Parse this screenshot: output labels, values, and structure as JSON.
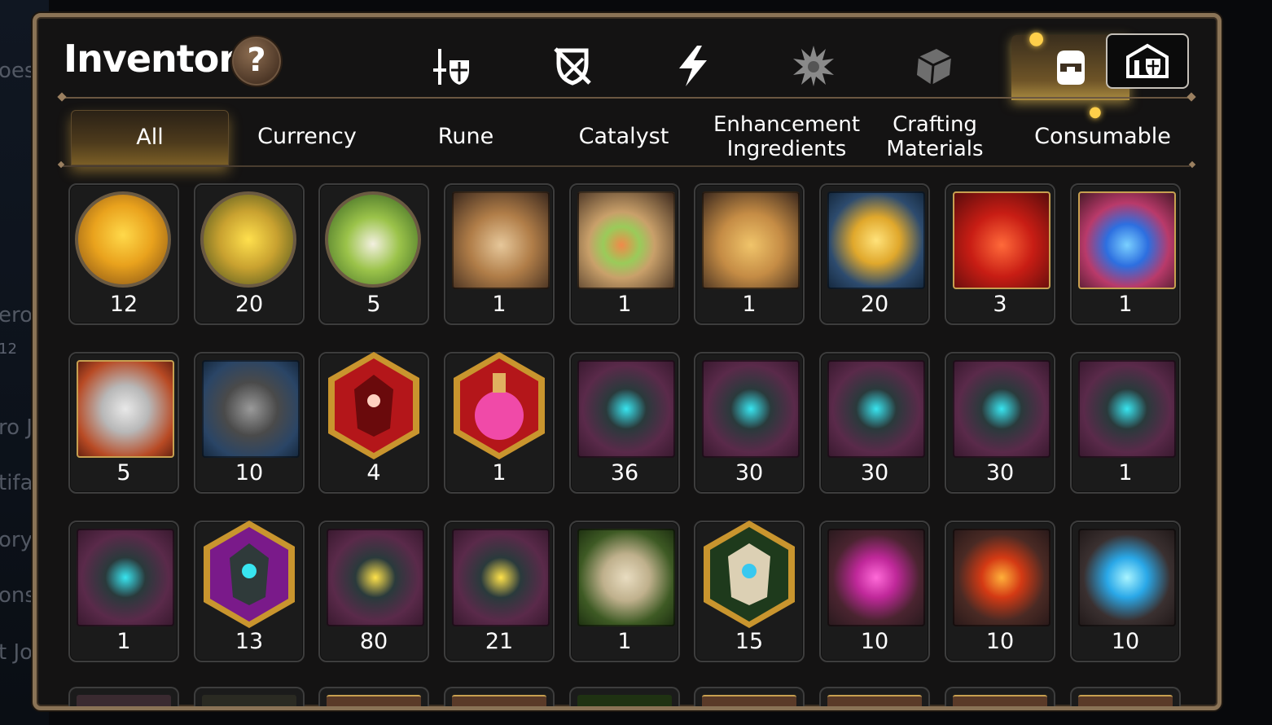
{
  "title": "Inventory",
  "help_label": "?",
  "background_words": [
    "oes",
    "ero",
    "12",
    "ro J",
    "tifa",
    "ory",
    "ons",
    "t Jo"
  ],
  "top_tabs": [
    {
      "name": "heroes-tab",
      "icon": "sword-shield-icon",
      "active": false
    },
    {
      "name": "equipment-tab",
      "icon": "no-sword-shield-icon",
      "active": false
    },
    {
      "name": "skills-tab",
      "icon": "lightning-icon",
      "active": false
    },
    {
      "name": "burst-tab",
      "icon": "burst-icon",
      "active": false
    },
    {
      "name": "cube-tab",
      "icon": "cube-icon",
      "active": false
    },
    {
      "name": "bag-tab",
      "icon": "bag-icon",
      "active": true
    }
  ],
  "shop_icon": "hero-shop-icon",
  "sub_tabs": [
    "All",
    "Currency",
    "Rune",
    "Catalyst",
    "Enhancement Ingredients",
    "Crafting Materials",
    "Consumable"
  ],
  "active_sub_tab": "All",
  "items": [
    {
      "icon": "gold-chick-icon",
      "qty": "12"
    },
    {
      "icon": "deer-chick-icon",
      "qty": "20"
    },
    {
      "icon": "leaf-chick-icon",
      "qty": "5"
    },
    {
      "icon": "scroll-fire-icon",
      "qty": "1"
    },
    {
      "icon": "scroll-rainbow-icon",
      "qty": "1"
    },
    {
      "icon": "scroll-gold-icon",
      "qty": "1"
    },
    {
      "icon": "gold-crystal-cluster-icon",
      "qty": "20"
    },
    {
      "icon": "red-potion-icon",
      "qty": "3"
    },
    {
      "icon": "star-potion-icon",
      "qty": "1"
    },
    {
      "icon": "gold-chest-icon",
      "qty": "5"
    },
    {
      "icon": "silver-chest-icon",
      "qty": "10"
    },
    {
      "icon": "red-star-stone-icon",
      "qty": "4"
    },
    {
      "icon": "pink-potion-icon",
      "qty": "1"
    },
    {
      "icon": "rune-sword-icon",
      "qty": "36"
    },
    {
      "icon": "rune-helmet-icon",
      "qty": "30"
    },
    {
      "icon": "rune-armor-icon",
      "qty": "30"
    },
    {
      "icon": "rune-boot-icon",
      "qty": "30"
    },
    {
      "icon": "rune-ring-icon",
      "qty": "1"
    },
    {
      "icon": "rune-necklace-icon",
      "qty": "1"
    },
    {
      "icon": "purple-star-rune-icon",
      "qty": "13"
    },
    {
      "icon": "gold-hammer-rune-icon",
      "qty": "80"
    },
    {
      "icon": "gold-bolt-rune-icon",
      "qty": "21"
    },
    {
      "icon": "stone-sword-rune-icon",
      "qty": "1"
    },
    {
      "icon": "stone-star-rune-icon",
      "qty": "15"
    },
    {
      "icon": "pink-orb-icon",
      "qty": "10"
    },
    {
      "icon": "fire-orb-icon",
      "qty": "10"
    },
    {
      "icon": "ice-orb-icon",
      "qty": "10"
    }
  ],
  "colors": {
    "frame": "#8a7356",
    "active_glow": "#e8b74a",
    "slot_border": "#3d3d3d",
    "rune_bg_purple": "#5a2a4a",
    "rune_glow": "#38e5f0"
  }
}
